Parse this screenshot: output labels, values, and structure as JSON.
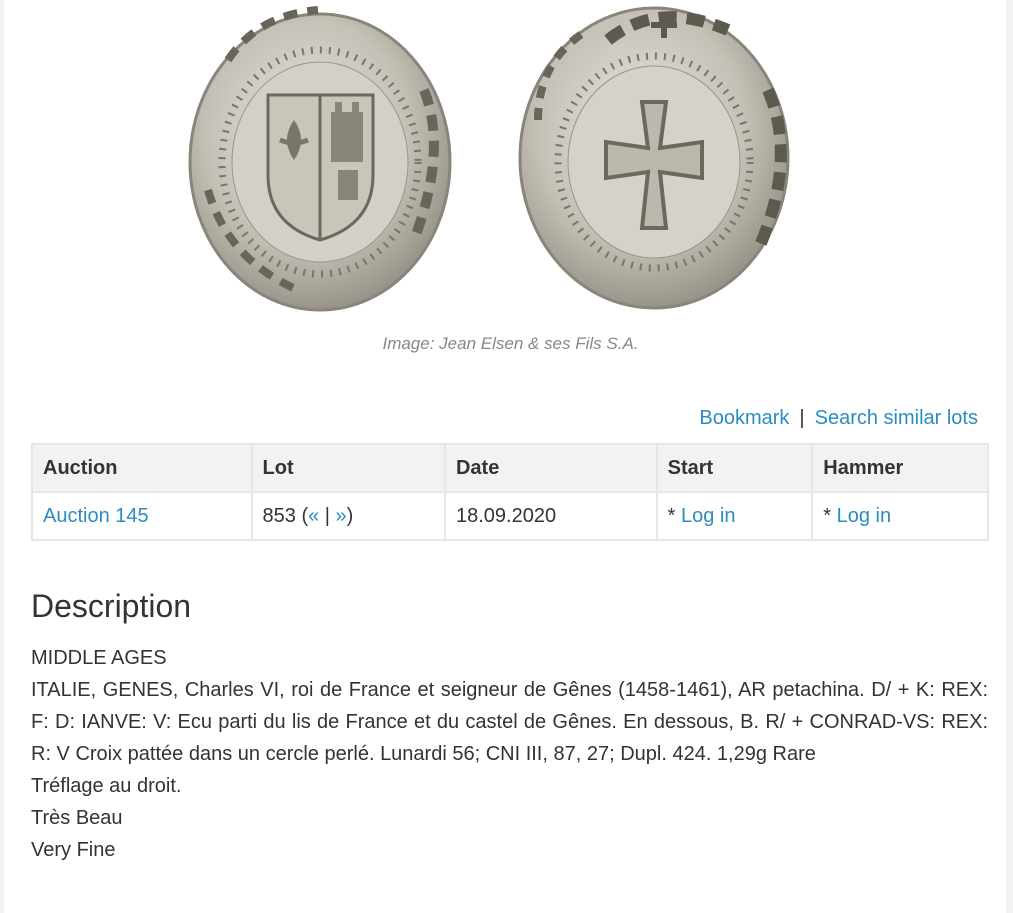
{
  "image": {
    "caption": "Image: Jean Elsen & ses Fils S.A.",
    "obverse_icon": "coin-obverse-shield",
    "reverse_icon": "coin-reverse-cross"
  },
  "actions": {
    "bookmark": "Bookmark",
    "separator": "|",
    "search_similar": "Search similar lots"
  },
  "table": {
    "headers": [
      "Auction",
      "Lot",
      "Date",
      "Start",
      "Hammer"
    ],
    "row": {
      "auction": "Auction 145",
      "lot_number": "853 (",
      "lot_prev": "«",
      "lot_sep": " | ",
      "lot_next": "»",
      "lot_close": ")",
      "date": "18.09.2020",
      "start_prefix": "* ",
      "start_link": "Log in",
      "hammer_prefix": "* ",
      "hammer_link": "Log in"
    }
  },
  "description": {
    "title": "Description",
    "lines": [
      "MIDDLE AGES",
      "ITALIE, GENES, Charles VI, roi de France et seigneur de Gênes (1458-1461), AR petachina. D/ + K: REX: F: D: IANVE: V: Ecu parti du lis de France et du castel de Gênes. En dessous, B. R/ + CONRAD-VS: REX: R: V Croix pattée dans un cercle perlé. Lunardi 56; CNI III, 87, 27; Dupl. 424. 1,29g Rare",
      "Tréflage au droit.",
      "Très Beau",
      "Very Fine"
    ]
  },
  "colors": {
    "link": "#2a8dbf",
    "table_header_bg": "#f2f2f2",
    "table_border": "#e6e6e6",
    "coin_silver": "#bdb8ad"
  }
}
